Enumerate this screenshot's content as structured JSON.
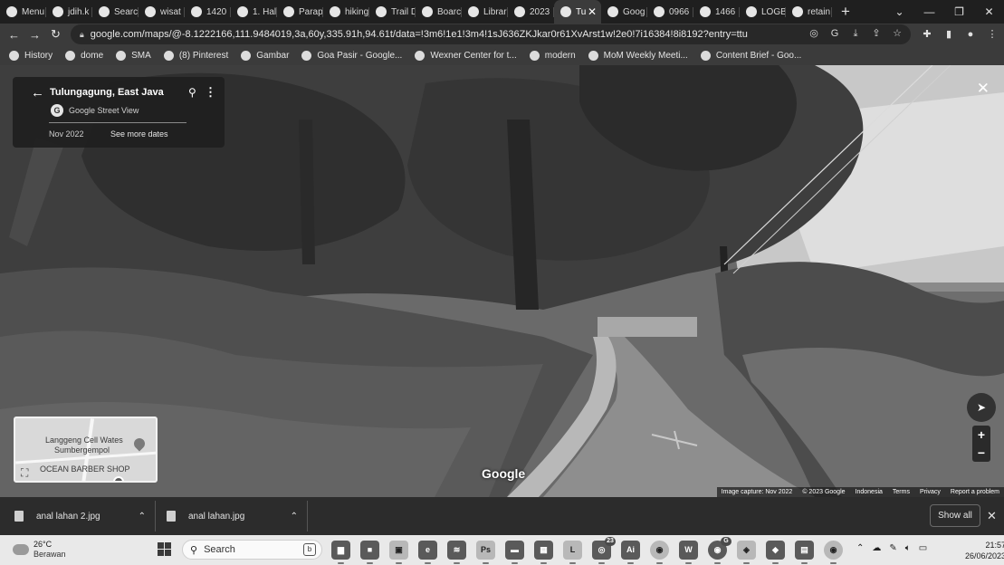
{
  "tabs": [
    {
      "label": "Menu",
      "icon": "g-icon"
    },
    {
      "label": "jdih.k",
      "icon": "shield-icon"
    },
    {
      "label": "Searc",
      "icon": "globe-icon"
    },
    {
      "label": "wisat",
      "icon": "g-icon"
    },
    {
      "label": "1420",
      "icon": "doc-icon"
    },
    {
      "label": "1. Hal",
      "icon": "diamond-icon"
    },
    {
      "label": "Parap",
      "icon": "q-icon"
    },
    {
      "label": "hiking",
      "icon": "g-icon"
    },
    {
      "label": "Trail D",
      "icon": "compass-icon"
    },
    {
      "label": "Boarc",
      "icon": "pen-icon"
    },
    {
      "label": "Librar",
      "icon": "book-icon"
    },
    {
      "label": "2023",
      "icon": "drive-icon"
    },
    {
      "label": "Tu",
      "icon": "maps-pin-icon",
      "active": true
    },
    {
      "label": "Goog",
      "icon": "globe-icon"
    },
    {
      "label": "0966",
      "icon": "doc-icon"
    },
    {
      "label": "1466",
      "icon": "doc-icon"
    },
    {
      "label": "LOGB",
      "icon": "w-icon"
    },
    {
      "label": "retain",
      "icon": "g-icon"
    }
  ],
  "window": {
    "tab_search": "⌄",
    "minimize": "—",
    "restore": "❐",
    "close": "✕"
  },
  "toolbar": {
    "url": "google.com/maps/@-8.1222166,111.9484019,3a,60y,335.91h,94.61t/data=!3m6!1e1!3m4!1sJ636ZKJkar0r61XvArst1w!2e0!7i16384!8i8192?entry=ttu"
  },
  "bookmarks": [
    {
      "label": "History",
      "icon": "clock-icon"
    },
    {
      "label": "dome",
      "icon": "w-icon"
    },
    {
      "label": "SMA",
      "icon": "globe-icon"
    },
    {
      "label": "(8) Pinterest",
      "icon": "pinterest-icon"
    },
    {
      "label": "Gambar",
      "icon": "wf-icon"
    },
    {
      "label": "Goa Pasir - Google...",
      "icon": "g-icon"
    },
    {
      "label": "Wexner Center for t...",
      "icon": "grid-icon"
    },
    {
      "label": "modern",
      "icon": "w-icon"
    },
    {
      "label": "MoM Weekly Meeti...",
      "icon": "doc-icon"
    },
    {
      "label": "Content Brief - Goo...",
      "icon": "drive-icon"
    }
  ],
  "streetview": {
    "place": "Tulungagung, East Java",
    "source": "Google Street View",
    "date": "Nov 2022",
    "see_more": "See more dates",
    "google_mark": "Google",
    "footer": [
      "Image capture: Nov 2022",
      "© 2023 Google",
      "Indonesia",
      "Terms",
      "Privacy",
      "Report a problem"
    ]
  },
  "minimap": {
    "labels": [
      "Langgeng Cell Wates",
      "Sumbergempol",
      "OCEAN BARBER SHOP"
    ]
  },
  "downloads": [
    {
      "name": "anal lahan 2.jpg"
    },
    {
      "name": "anal lahan.jpg"
    }
  ],
  "shelf": {
    "show_all": "Show all"
  },
  "taskbar": {
    "temperature": "26°C",
    "condition": "Berawan",
    "search_placeholder": "Search",
    "apps": [
      {
        "name": "file-explorer-icon",
        "glyph": "▆"
      },
      {
        "name": "video-call-icon",
        "glyph": "■"
      },
      {
        "name": "photos-icon",
        "glyph": "▣"
      },
      {
        "name": "edge-icon",
        "glyph": "e"
      },
      {
        "name": "spotify-icon",
        "glyph": "≋"
      },
      {
        "name": "photoshop-icon",
        "glyph": "Ps"
      },
      {
        "name": "folder-icon",
        "glyph": "▬"
      },
      {
        "name": "store-icon",
        "glyph": "▦"
      },
      {
        "name": "l-app-icon",
        "glyph": "L"
      },
      {
        "name": "whatsapp-icon",
        "glyph": "◎",
        "badge": "23"
      },
      {
        "name": "illustrator-icon",
        "glyph": "Ai"
      },
      {
        "name": "chrome-icon",
        "glyph": "◉"
      },
      {
        "name": "word-icon",
        "glyph": "W"
      },
      {
        "name": "chrome-profile-icon",
        "glyph": "◉",
        "badge": "G"
      },
      {
        "name": "app-icon",
        "glyph": "◈"
      },
      {
        "name": "app2-icon",
        "glyph": "◆"
      },
      {
        "name": "app3-icon",
        "glyph": "▤"
      },
      {
        "name": "chrome-dev-icon",
        "glyph": "◉"
      }
    ],
    "time": "21:57",
    "date": "26/06/2023"
  }
}
